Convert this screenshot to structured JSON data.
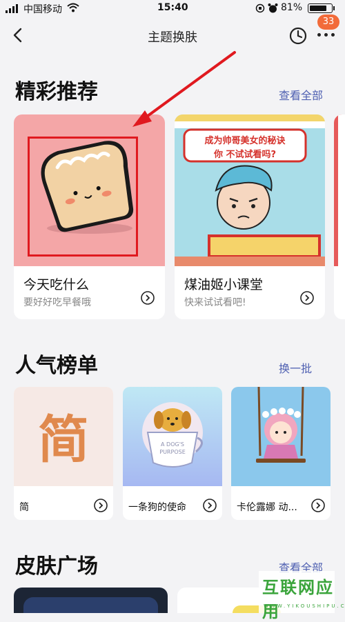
{
  "status_bar": {
    "carrier": "中国移动",
    "time": "15:40",
    "battery_pct": "81%",
    "battery_level": 0.81
  },
  "nav": {
    "title": "主题换肤",
    "badge": "33"
  },
  "featured": {
    "title": "精彩推荐",
    "link": "查看全部",
    "cards": [
      {
        "title": "今天吃什么",
        "subtitle": "要好好吃早餐哦"
      },
      {
        "title": "煤油姬小课堂",
        "subtitle": "快来试试看吧!",
        "image_text_1": "成为帅哥美女的秘诀",
        "image_text_2": "你 不试试看吗?"
      }
    ]
  },
  "popular": {
    "title": "人气榜单",
    "link": "换一批",
    "cards": [
      {
        "title": "简",
        "image_text": "简"
      },
      {
        "title": "一条狗的使命",
        "image_text_1": "A DOG'S",
        "image_text_2": "PURPOSE"
      },
      {
        "title": "卡伦露娜 动..."
      }
    ]
  },
  "skins": {
    "title": "皮肤广场",
    "link": "查看全部"
  },
  "watermark": {
    "title": "互联网应用",
    "subtitle": "WWW.YIKOUSHIPU.COM"
  },
  "colors": {
    "accent_link": "#4e5fb1",
    "badge": "#f26b3a",
    "highlight_box": "#e0191f",
    "annotation_arrow": "#e0191f",
    "watermark": "#3aa43b"
  }
}
